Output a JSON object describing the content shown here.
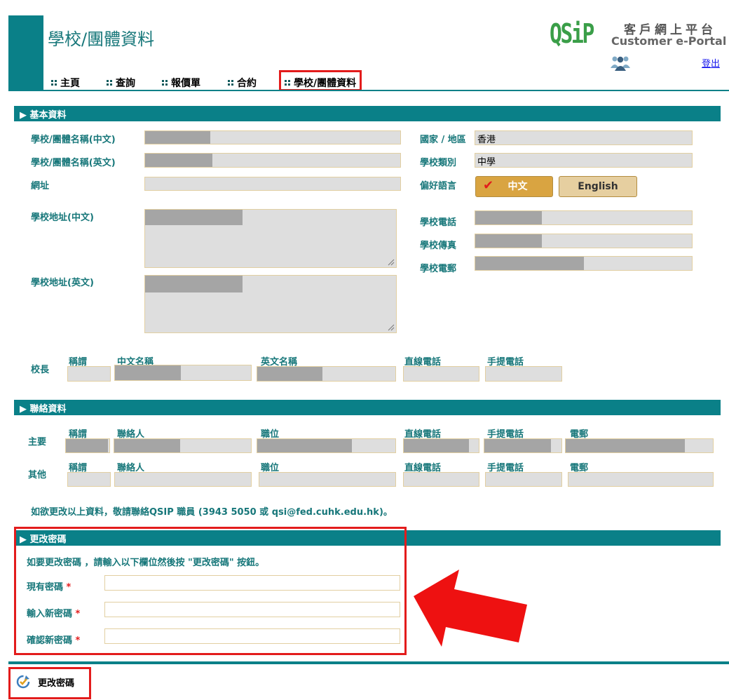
{
  "header": {
    "title": "學校/團體資料",
    "logo": "QSiP",
    "portal_zh": "客戶網上平台",
    "portal_en": "Customer e-Portal",
    "logout": "登出"
  },
  "nav": {
    "items": [
      {
        "label": "主頁"
      },
      {
        "label": "查詢"
      },
      {
        "label": "報價單"
      },
      {
        "label": "合約"
      },
      {
        "label": "學校/團體資料"
      }
    ],
    "active": "學校/團體資料"
  },
  "basic": {
    "section_title": "▶ 基本資料",
    "name_zh_label": "學校/團體名稱(中文)",
    "name_en_label": "學校/團體名稱(英文)",
    "website_label": "網址",
    "addr_zh_label": "學校地址(中文)",
    "addr_en_label": "學校地址(英文)",
    "country_label": "國家 / 地區",
    "country_value": "香港",
    "type_label": "學校類別",
    "type_value": "中學",
    "lang_label": "偏好語言",
    "lang_zh": "中文",
    "lang_en": "English",
    "lang_selected": "中文",
    "phone_label": "學校電話",
    "fax_label": "學校傳真",
    "email_label": "學校電郵",
    "principal_label": "校長",
    "title_header": "稱謂",
    "name_zh_header": "中文名稱",
    "name_en_header": "英文名稱",
    "direct_header": "直線電話",
    "mobile_header": "手提電話"
  },
  "contact": {
    "section_title": "▶ 聯絡資料",
    "main_label": "主要",
    "other_label": "其他",
    "title_header": "稱謂",
    "contact_header": "聯絡人",
    "position_header": "職位",
    "direct_header": "直線電話",
    "mobile_header": "手提電話",
    "email_header": "電郵",
    "note": "如欲更改以上資料，敬請聯絡QSIP 職員 (3943 5050 或 qsi@fed.cuhk.edu.hk)。"
  },
  "password": {
    "section_title": "▶ 更改密碼",
    "instruction": "如要更改密碼 ，請輸入以下欄位然後按 \"更改密碼\" 按鈕。",
    "current_label": "現有密碼",
    "new_label": "輸入新密碼",
    "confirm_label": "確認新密碼",
    "required_mark": "*",
    "button_label": "更改密碼"
  },
  "colors": {
    "teal": "#0a8088",
    "highlight": "#e31c1c",
    "gold": "#d9a441",
    "beige": "#e6cfa0"
  }
}
